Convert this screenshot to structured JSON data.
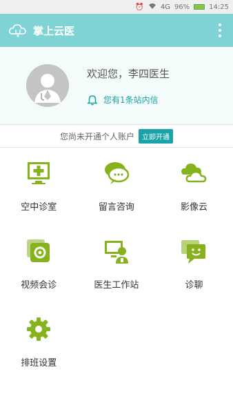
{
  "status_bar": {
    "battery": "96%",
    "time": "14:25",
    "signal": "4G"
  },
  "app_bar": {
    "title": "掌上云医"
  },
  "profile": {
    "welcome": "欢迎您，李四医生",
    "notice": "您有1条站内信"
  },
  "account": {
    "text": "您尚未开通个人账户",
    "button": "立即开通"
  },
  "colors": {
    "header": "#7fd3d4",
    "accent": "#18a3a6",
    "icon": "#86b21e"
  },
  "menu": [
    {
      "label": "空中诊室",
      "icon": "monitor-plus-icon"
    },
    {
      "label": "留言咨询",
      "icon": "chat-bubble-icon"
    },
    {
      "label": "影像云",
      "icon": "cloud-icon"
    },
    {
      "label": "视频会诊",
      "icon": "video-camera-icon"
    },
    {
      "label": "医生工作站",
      "icon": "doctor-workstation-icon"
    },
    {
      "label": "诊聊",
      "icon": "smile-chat-icon"
    },
    {
      "label": "排班设置",
      "icon": "gear-icon"
    }
  ]
}
